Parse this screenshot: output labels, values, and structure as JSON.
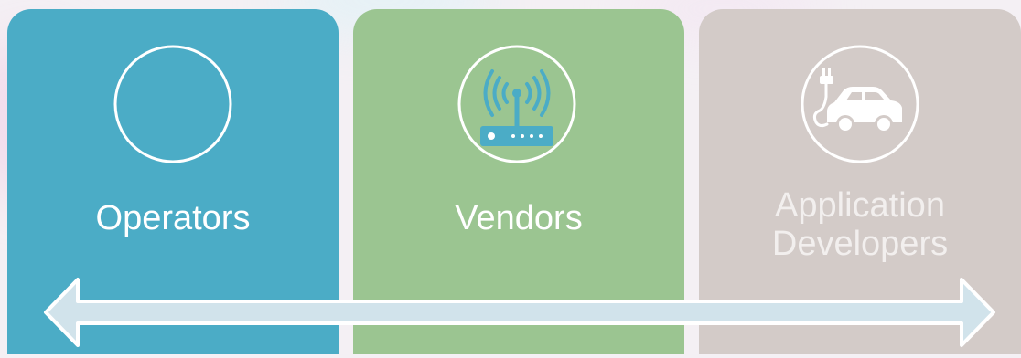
{
  "diagram": {
    "cards": [
      {
        "label": "Operators",
        "icon": "empty-circle-icon",
        "color": "#4bacc6"
      },
      {
        "label": "Vendors",
        "icon": "wifi-router-icon",
        "color": "#9bc591"
      },
      {
        "label": "Application Developers",
        "label_lines": [
          "Application",
          "Developers"
        ],
        "icon": "electric-car-icon",
        "color": "#d3cbc8"
      }
    ],
    "connector": {
      "type": "double-headed-arrow",
      "color": "#d1e3eb"
    }
  }
}
